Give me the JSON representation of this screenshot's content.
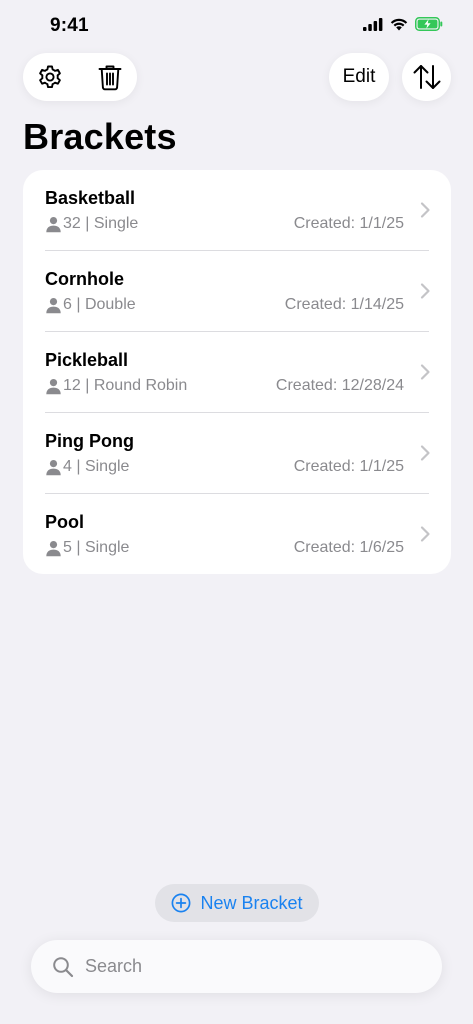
{
  "status_bar": {
    "time": "9:41"
  },
  "toolbar": {
    "edit_label": "Edit"
  },
  "page": {
    "title": "Brackets"
  },
  "brackets": [
    {
      "name": "Basketball",
      "meta": "32 | Single",
      "created": "Created: 1/1/25"
    },
    {
      "name": "Cornhole",
      "meta": "6 | Double",
      "created": "Created: 1/14/25"
    },
    {
      "name": "Pickleball",
      "meta": "12 | Round Robin",
      "created": "Created: 12/28/24"
    },
    {
      "name": "Ping Pong",
      "meta": "4 | Single",
      "created": "Created: 1/1/25"
    },
    {
      "name": "Pool",
      "meta": "5 | Single",
      "created": "Created: 1/6/25"
    }
  ],
  "new_bracket": {
    "label": "New Bracket"
  },
  "search": {
    "placeholder": "Search"
  },
  "colors": {
    "accent": "#1a82f0",
    "secondary_text": "#8a8a8e",
    "background": "#f2f1f6",
    "battery": "#34c759"
  },
  "icons": [
    "settings-gear-icon",
    "trash-icon",
    "sort-arrows-icon",
    "person-icon",
    "chevron-right-icon",
    "plus-circle-icon",
    "search-icon",
    "cellular-signal-icon",
    "wifi-icon",
    "battery-charging-icon"
  ]
}
